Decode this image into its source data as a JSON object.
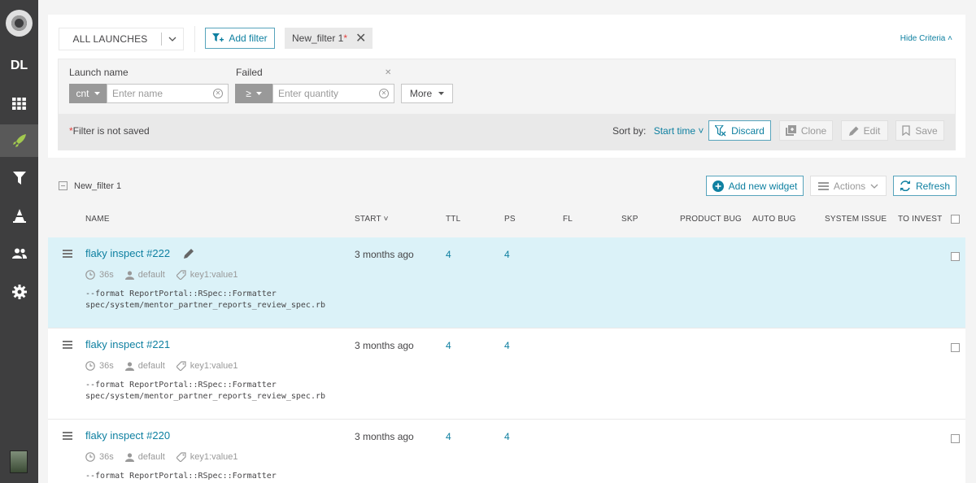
{
  "sidebar": {
    "project_code": "DL",
    "items": [
      "dashboard-icon",
      "launches-icon",
      "filters-icon",
      "debug-icon",
      "members-icon",
      "settings-icon"
    ]
  },
  "filter_bar": {
    "launch_mode": "ALL LAUNCHES",
    "add_filter": "Add filter",
    "filter_name": "New_filter 1",
    "unsaved_mark": "*",
    "hide_criteria": "Hide Criteria"
  },
  "criteria": {
    "launch_name_label": "Launch name",
    "launch_name_condition": "cnt",
    "launch_name_placeholder": "Enter name",
    "failed_label": "Failed",
    "failed_condition": "≥",
    "failed_placeholder": "Enter quantity",
    "more": "More",
    "not_saved": "Filter is not saved",
    "sort_by_label": "Sort by:",
    "sort_by_value": "Start time",
    "discard": "Discard",
    "clone": "Clone",
    "edit": "Edit",
    "save": "Save"
  },
  "toolbar": {
    "filter_name": "New_filter 1",
    "add_widget": "Add new widget",
    "actions": "Actions",
    "refresh": "Refresh"
  },
  "columns": [
    "NAME",
    "START",
    "TTL",
    "PS",
    "FL",
    "SKP",
    "PRODUCT BUG",
    "AUTO BUG",
    "SYSTEM ISSUE",
    "TO INVEST"
  ],
  "launches": [
    {
      "name": "flaky inspect #222",
      "duration": "36s",
      "owner": "default",
      "tag": "key1:value1",
      "desc1": "--format ReportPortal::RSpec::Formatter",
      "desc2": "spec/system/mentor_partner_reports_review_spec.rb",
      "start": "3 months ago",
      "ttl": "4",
      "ps": "4"
    },
    {
      "name": "flaky inspect #221",
      "duration": "36s",
      "owner": "default",
      "tag": "key1:value1",
      "desc1": "--format ReportPortal::RSpec::Formatter",
      "desc2": "spec/system/mentor_partner_reports_review_spec.rb",
      "start": "3 months ago",
      "ttl": "4",
      "ps": "4"
    },
    {
      "name": "flaky inspect #220",
      "duration": "36s",
      "owner": "default",
      "tag": "key1:value1",
      "desc1": "--format ReportPortal::RSpec::Formatter",
      "desc2": "",
      "start": "3 months ago",
      "ttl": "4",
      "ps": "4"
    }
  ]
}
